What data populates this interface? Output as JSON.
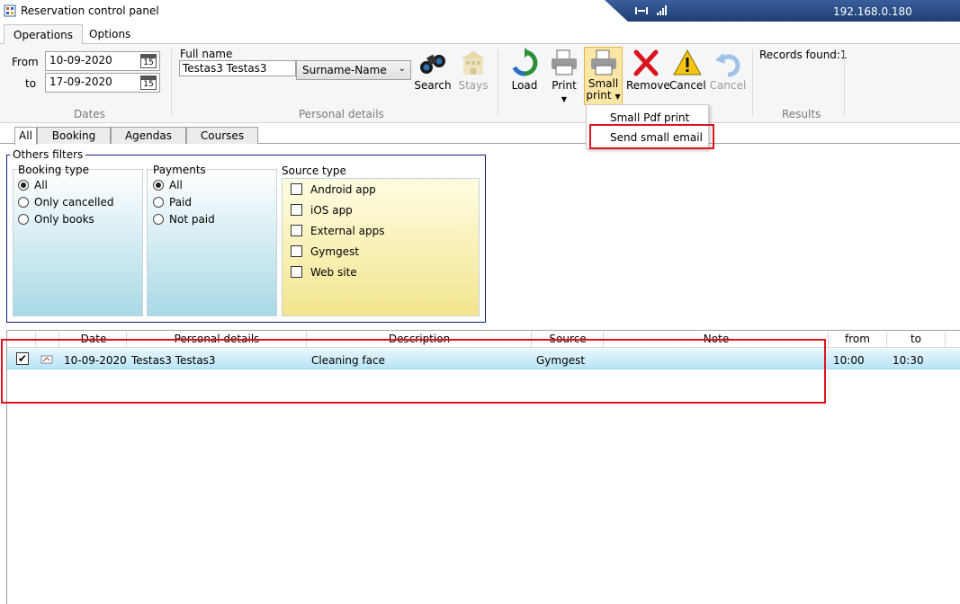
{
  "window": {
    "title": "Reservation control panel",
    "ip": "192.168.0.180"
  },
  "ribbon_tabs": [
    "Operations",
    "Options"
  ],
  "dates": {
    "from_label": "From",
    "to_label": "to",
    "from_value": "10-09-2020",
    "to_value": "17-09-2020",
    "calendar_day": "15",
    "group_label": "Dates"
  },
  "personal": {
    "full_name_label": "Full name",
    "full_name_value": "Testas3 Testas3",
    "sort_value": "Surname-Name",
    "group_label": "Personal details"
  },
  "buttons": {
    "search": "Search",
    "stays": "Stays",
    "load": "Load",
    "print": "Print",
    "small_print_line1": "Small",
    "small_print_line2": "print",
    "remove": "Remove",
    "cancel": "Cancel",
    "cancel_disabled": "Cancel"
  },
  "results": {
    "records_found": "Records found:1",
    "group_label": "Results"
  },
  "dropdown": {
    "items": [
      "Small Pdf print",
      "Send small email"
    ]
  },
  "content_tabs": [
    "All",
    "Booking",
    "Agendas",
    "Courses"
  ],
  "filters": {
    "legend": "Others filters",
    "booking_type": {
      "title": "Booking type",
      "options": [
        "All",
        "Only cancelled",
        "Only books"
      ]
    },
    "payments": {
      "title": "Payments",
      "options": [
        "All",
        "Paid",
        "Not paid"
      ]
    },
    "source_type": {
      "title": "Source type",
      "options": [
        "Android app",
        "iOS app",
        "External apps",
        "Gymgest",
        "Web site"
      ]
    }
  },
  "grid": {
    "columns": [
      "Date",
      "Personal details",
      "Description",
      "Source",
      "Note",
      "from",
      "to"
    ],
    "rows": [
      {
        "checked": "✔",
        "date": "10-09-2020",
        "personal": "Testas3 Testas3",
        "description": "Cleaning face",
        "source": "Gymgest",
        "note": "",
        "from": "10:00",
        "to": "10:30"
      }
    ]
  },
  "colors": {
    "accent": "#1f3d72",
    "highlight_red": "#e0141e",
    "row_selected": "#b9e4f7",
    "filter_blue": "#a9d9e6",
    "filter_yellow": "#f2e58f"
  }
}
